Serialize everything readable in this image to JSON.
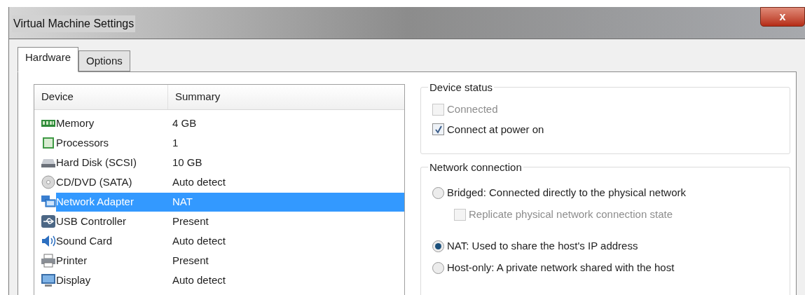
{
  "window": {
    "title": "Virtual Machine Settings",
    "close_button": "x"
  },
  "tabs": [
    {
      "label": "Hardware",
      "selected": true
    },
    {
      "label": "Options",
      "selected": false
    }
  ],
  "device_list": {
    "columns": [
      "Device",
      "Summary"
    ],
    "rows": [
      {
        "kind": "memory",
        "device": "Memory",
        "summary": "4 GB",
        "selected": false
      },
      {
        "kind": "processor",
        "device": "Processors",
        "summary": "1",
        "selected": false
      },
      {
        "kind": "disk",
        "device": "Hard Disk (SCSI)",
        "summary": "10 GB",
        "selected": false
      },
      {
        "kind": "cd",
        "device": "CD/DVD (SATA)",
        "summary": "Auto detect",
        "selected": false
      },
      {
        "kind": "network",
        "device": "Network Adapter",
        "summary": "NAT",
        "selected": true
      },
      {
        "kind": "usb",
        "device": "USB Controller",
        "summary": "Present",
        "selected": false
      },
      {
        "kind": "sound",
        "device": "Sound Card",
        "summary": "Auto detect",
        "selected": false
      },
      {
        "kind": "printer",
        "device": "Printer",
        "summary": "Present",
        "selected": false
      },
      {
        "kind": "display",
        "device": "Display",
        "summary": "Auto detect",
        "selected": false
      }
    ]
  },
  "device_status": {
    "title": "Device status",
    "options": [
      {
        "label": "Connected",
        "checked": false,
        "disabled": true
      },
      {
        "label": "Connect at power on",
        "checked": true,
        "disabled": false
      }
    ]
  },
  "network_connection": {
    "title": "Network connection",
    "options": [
      {
        "kind": "radio",
        "label": "Bridged: Connected directly to the physical network",
        "selected": false,
        "disabled": false
      },
      {
        "kind": "checkbox",
        "label": "Replicate physical network connection state",
        "checked": false,
        "disabled": true
      },
      {
        "kind": "radio",
        "label": "NAT: Used to share the host's IP address",
        "selected": true,
        "disabled": false
      },
      {
        "kind": "radio",
        "label": "Host-only: A private network shared with the host",
        "selected": false,
        "disabled": false
      }
    ]
  }
}
